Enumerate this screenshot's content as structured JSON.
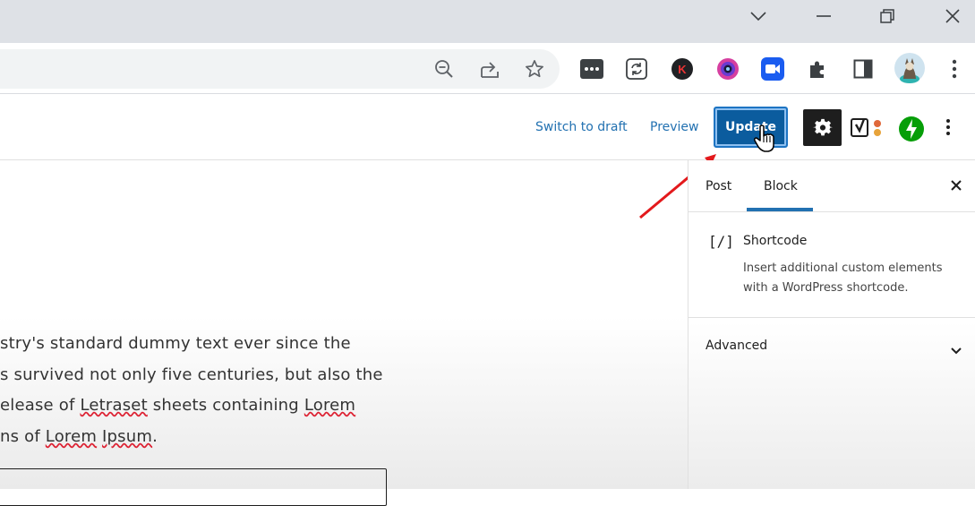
{
  "browser": {
    "window_controls": [
      "chevron-down-icon",
      "minimize-icon",
      "restore-icon",
      "close-icon"
    ],
    "omnibox_icons": [
      "zoom-out-icon",
      "share-icon",
      "star-icon"
    ],
    "extensions": [
      "more-dots-extension-icon",
      "sync-extension-icon",
      "k-extension-icon",
      "camera-extension-icon",
      "video-extension-icon",
      "puzzle-icon",
      "side-panel-icon"
    ],
    "profile": "avatar"
  },
  "editor_header": {
    "switch_to_draft": "Switch to draft",
    "preview": "Preview",
    "update": "Update"
  },
  "content": {
    "lines": [
      [
        {
          "t": "stry's standard dummy text ever since the"
        }
      ],
      [
        {
          "t": "s survived not only five centuries, but also the"
        }
      ],
      [
        {
          "t": "elease of "
        },
        {
          "t": "Letraset",
          "u": true
        },
        {
          "t": " sheets containing "
        },
        {
          "t": "Lorem",
          "u": true
        }
      ],
      [
        {
          "t": "ns of "
        },
        {
          "t": "Lorem",
          "u": true
        },
        {
          "t": " "
        },
        {
          "t": "Ipsum",
          "u": true
        },
        {
          "t": "."
        }
      ]
    ]
  },
  "sidebar": {
    "tabs": [
      "Post",
      "Block"
    ],
    "active_tab": "Block",
    "block": {
      "icon_text": "[/]",
      "title": "Shortcode",
      "description_line1": "Insert additional custom elements",
      "description_line2": "with a WordPress shortcode."
    },
    "advanced": "Advanced"
  },
  "colors": {
    "accent": "#2271b1",
    "update_button": "#0b5c9e",
    "arrow": "#e3191c"
  }
}
